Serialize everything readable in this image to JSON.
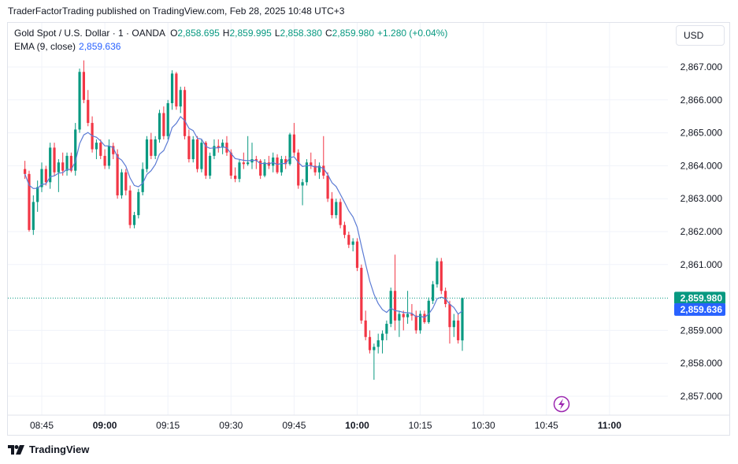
{
  "publisher_line": "TraderFactorTrading published on TradingView.com, Feb 28, 2025 10:48 UTC+3",
  "legend": {
    "symbol": "Gold Spot / U.S. Dollar · 1 · OANDA",
    "o_label": "O",
    "o_value": "2,858.695",
    "h_label": "H",
    "h_value": "2,859.995",
    "l_label": "L",
    "l_value": "2,858.380",
    "c_label": "C",
    "c_value": "2,859.980",
    "change": "+1.280 (+0.04%)",
    "ema_label": "EMA (9, close)",
    "ema_value": "2,859.636"
  },
  "currency": "USD",
  "footer": {
    "brand": "TradingView"
  },
  "colors": {
    "up": "#089981",
    "down": "#f23645",
    "ema": "#5b7bd4",
    "price_label": "#089981",
    "ema_label": "#2962ff",
    "grid": "#f0f3fa",
    "axis_text": "#131722"
  },
  "chart_data": {
    "type": "candlestick",
    "x_unit": "minutes since 08:40 (Feb 28, 2025, UTC+3)",
    "y_ticks": [
      "2,867.000",
      "2,866.000",
      "2,865.000",
      "2,864.000",
      "2,863.000",
      "2,862.000",
      "2,861.000",
      "2,859.000",
      "2,858.000",
      "2,857.000"
    ],
    "y_tick_values": [
      2867,
      2866,
      2865,
      2864,
      2863,
      2862,
      2861,
      2859,
      2858,
      2857
    ],
    "x_ticks": [
      {
        "label": "08:45",
        "t": 5,
        "bold": false
      },
      {
        "label": "09:00",
        "t": 20,
        "bold": true
      },
      {
        "label": "09:15",
        "t": 35,
        "bold": false
      },
      {
        "label": "09:30",
        "t": 50,
        "bold": false
      },
      {
        "label": "09:45",
        "t": 65,
        "bold": false
      },
      {
        "label": "10:00",
        "t": 80,
        "bold": true
      },
      {
        "label": "10:15",
        "t": 95,
        "bold": false
      },
      {
        "label": "10:30",
        "t": 110,
        "bold": false
      },
      {
        "label": "10:45",
        "t": 125,
        "bold": false
      },
      {
        "label": "11:00",
        "t": 140,
        "bold": true
      }
    ],
    "last_price": 2859.98,
    "last_price_label": "2,859.980",
    "ema_last": 2859.636,
    "ema_last_label": "2,859.636",
    "candles": [
      [
        2863.9,
        2864.15,
        2863.6,
        2863.75
      ],
      [
        2863.75,
        2863.85,
        2862.0,
        2862.05
      ],
      [
        2862.05,
        2863.1,
        2861.9,
        2862.9
      ],
      [
        2862.9,
        2863.55,
        2862.6,
        2863.35
      ],
      [
        2863.35,
        2864.1,
        2863.2,
        2863.9
      ],
      [
        2863.9,
        2864.0,
        2863.4,
        2863.5
      ],
      [
        2863.5,
        2864.7,
        2863.3,
        2864.55
      ],
      [
        2864.55,
        2864.7,
        2863.7,
        2863.8
      ],
      [
        2863.8,
        2864.2,
        2863.2,
        2864.1
      ],
      [
        2864.1,
        2864.4,
        2863.7,
        2863.85
      ],
      [
        2863.85,
        2864.4,
        2863.7,
        2864.3
      ],
      [
        2864.3,
        2864.4,
        2863.8,
        2863.85
      ],
      [
        2863.85,
        2865.3,
        2863.7,
        2865.1
      ],
      [
        2865.1,
        2866.95,
        2865.0,
        2866.85
      ],
      [
        2866.85,
        2867.2,
        2865.9,
        2866.0
      ],
      [
        2866.0,
        2866.3,
        2865.2,
        2865.3
      ],
      [
        2865.3,
        2865.5,
        2864.4,
        2864.5
      ],
      [
        2864.5,
        2864.8,
        2864.2,
        2864.7
      ],
      [
        2864.7,
        2864.8,
        2864.2,
        2864.3
      ],
      [
        2864.3,
        2864.5,
        2863.9,
        2864.0
      ],
      [
        2864.0,
        2864.8,
        2863.9,
        2864.6
      ],
      [
        2864.6,
        2864.7,
        2864.2,
        2864.35
      ],
      [
        2864.35,
        2864.5,
        2863.0,
        2863.1
      ],
      [
        2863.1,
        2863.9,
        2863.0,
        2863.8
      ],
      [
        2863.8,
        2863.9,
        2863.1,
        2863.25
      ],
      [
        2863.25,
        2863.4,
        2862.1,
        2862.2
      ],
      [
        2862.2,
        2862.6,
        2862.1,
        2862.5
      ],
      [
        2862.5,
        2863.3,
        2862.4,
        2863.2
      ],
      [
        2863.2,
        2864.1,
        2863.1,
        2863.9
      ],
      [
        2863.9,
        2864.9,
        2863.8,
        2864.8
      ],
      [
        2864.8,
        2865.0,
        2864.2,
        2864.3
      ],
      [
        2864.3,
        2864.9,
        2864.2,
        2864.8
      ],
      [
        2864.8,
        2865.7,
        2864.7,
        2865.6
      ],
      [
        2865.6,
        2865.8,
        2864.8,
        2864.9
      ],
      [
        2864.9,
        2866.0,
        2864.8,
        2865.9
      ],
      [
        2865.9,
        2866.9,
        2865.7,
        2866.8
      ],
      [
        2866.8,
        2866.85,
        2865.7,
        2865.8
      ],
      [
        2865.8,
        2866.4,
        2865.6,
        2866.3
      ],
      [
        2866.3,
        2866.4,
        2864.8,
        2864.9
      ],
      [
        2864.9,
        2865.1,
        2864.1,
        2864.2
      ],
      [
        2864.2,
        2864.9,
        2864.1,
        2864.8
      ],
      [
        2864.8,
        2864.9,
        2863.8,
        2863.9
      ],
      [
        2863.9,
        2864.8,
        2863.8,
        2864.7
      ],
      [
        2864.7,
        2864.75,
        2863.6,
        2863.7
      ],
      [
        2863.7,
        2864.4,
        2863.6,
        2864.3
      ],
      [
        2864.3,
        2864.8,
        2864.2,
        2864.6
      ],
      [
        2864.6,
        2864.8,
        2864.4,
        2864.55
      ],
      [
        2864.55,
        2864.8,
        2864.35,
        2864.7
      ],
      [
        2864.7,
        2864.9,
        2864.3,
        2864.4
      ],
      [
        2864.4,
        2864.5,
        2863.6,
        2863.7
      ],
      [
        2863.7,
        2863.95,
        2863.5,
        2863.6
      ],
      [
        2863.6,
        2864.2,
        2863.5,
        2864.1
      ],
      [
        2864.1,
        2864.4,
        2863.9,
        2864.05
      ],
      [
        2864.05,
        2864.9,
        2864.0,
        2864.1
      ],
      [
        2864.1,
        2864.7,
        2863.9,
        2864.2
      ],
      [
        2864.2,
        2864.3,
        2863.9,
        2864.15
      ],
      [
        2864.15,
        2864.2,
        2863.6,
        2863.7
      ],
      [
        2863.7,
        2864.2,
        2863.65,
        2864.1
      ],
      [
        2864.1,
        2864.3,
        2863.9,
        2864.0
      ],
      [
        2864.0,
        2864.4,
        2863.8,
        2864.25
      ],
      [
        2864.25,
        2864.35,
        2863.75,
        2863.8
      ],
      [
        2863.8,
        2864.3,
        2863.7,
        2864.2
      ],
      [
        2864.2,
        2864.3,
        2863.9,
        2864.05
      ],
      [
        2864.05,
        2865.0,
        2864.0,
        2864.95
      ],
      [
        2864.95,
        2865.3,
        2864.3,
        2864.4
      ],
      [
        2864.4,
        2864.5,
        2863.3,
        2863.4
      ],
      [
        2863.4,
        2863.6,
        2862.8,
        2863.5
      ],
      [
        2863.5,
        2864.2,
        2863.4,
        2864.1
      ],
      [
        2864.1,
        2864.4,
        2863.9,
        2864.0
      ],
      [
        2864.0,
        2864.2,
        2863.7,
        2863.8
      ],
      [
        2863.8,
        2864.1,
        2863.6,
        2864.0
      ],
      [
        2864.0,
        2864.9,
        2863.6,
        2863.7
      ],
      [
        2863.7,
        2863.8,
        2862.9,
        2863.0
      ],
      [
        2863.0,
        2863.2,
        2862.4,
        2862.5
      ],
      [
        2862.5,
        2863.0,
        2862.4,
        2862.9
      ],
      [
        2862.9,
        2863.0,
        2862.1,
        2862.2
      ],
      [
        2862.2,
        2862.3,
        2861.8,
        2861.9
      ],
      [
        2861.9,
        2862.0,
        2861.5,
        2861.6
      ],
      [
        2861.6,
        2861.8,
        2861.4,
        2861.7
      ],
      [
        2861.7,
        2861.8,
        2860.8,
        2860.9
      ],
      [
        2860.9,
        2861.0,
        2859.2,
        2859.3
      ],
      [
        2859.3,
        2859.6,
        2858.7,
        2858.8
      ],
      [
        2858.8,
        2859.0,
        2858.3,
        2858.4
      ],
      [
        2858.4,
        2858.6,
        2857.5,
        2858.5
      ],
      [
        2858.5,
        2858.9,
        2858.3,
        2858.7
      ],
      [
        2858.7,
        2859.0,
        2858.3,
        2858.9
      ],
      [
        2858.9,
        2859.3,
        2858.7,
        2859.2
      ],
      [
        2859.2,
        2860.3,
        2859.1,
        2860.2
      ],
      [
        2860.2,
        2861.3,
        2859.0,
        2859.3
      ],
      [
        2859.3,
        2859.6,
        2858.8,
        2859.5
      ],
      [
        2859.5,
        2859.6,
        2859.0,
        2859.4
      ],
      [
        2859.4,
        2860.2,
        2859.2,
        2859.5
      ],
      [
        2859.5,
        2859.8,
        2859.3,
        2859.45
      ],
      [
        2859.45,
        2859.6,
        2858.9,
        2859.0
      ],
      [
        2859.0,
        2859.6,
        2858.9,
        2859.5
      ],
      [
        2859.5,
        2859.6,
        2859.2,
        2859.25
      ],
      [
        2859.25,
        2860.0,
        2859.2,
        2859.9
      ],
      [
        2859.9,
        2860.5,
        2859.8,
        2860.4
      ],
      [
        2860.4,
        2861.2,
        2860.3,
        2861.1
      ],
      [
        2861.1,
        2861.2,
        2860.1,
        2860.2
      ],
      [
        2860.2,
        2860.3,
        2859.7,
        2859.8
      ],
      [
        2859.8,
        2859.9,
        2858.6,
        2859.1
      ],
      [
        2859.1,
        2859.5,
        2858.8,
        2859.3
      ],
      [
        2859.3,
        2859.5,
        2858.6,
        2858.7
      ],
      [
        2858.695,
        2859.995,
        2858.38,
        2859.98
      ]
    ],
    "ema_period": 9
  }
}
